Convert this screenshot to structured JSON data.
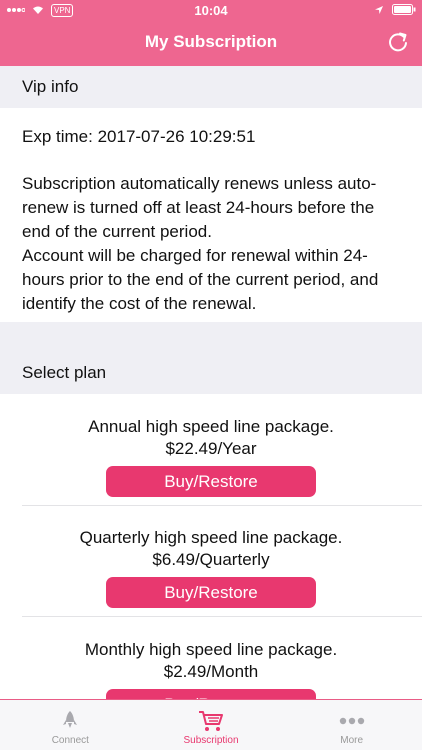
{
  "status_bar": {
    "vpn": "VPN",
    "time": "10:04"
  },
  "nav": {
    "title": "My Subscription",
    "refresh_icon": "refresh-icon"
  },
  "vip_info": {
    "header": "Vip info",
    "exp_time": "Exp time: 2017-07-26 10:29:51",
    "notice_1": "Subscription automatically renews unless auto-renew is turned off at least 24-hours before the end of the current period.",
    "notice_2": "Account will be charged for renewal within 24-hours prior to the end of the current period, and identify the cost of the renewal."
  },
  "select_plan": {
    "header": "Select plan",
    "plans": [
      {
        "name": "Annual high speed line package.",
        "price": "$22.49/Year",
        "button": "Buy/Restore"
      },
      {
        "name": "Quarterly high speed line package.",
        "price": "$6.49/Quarterly",
        "button": "Buy/Restore"
      },
      {
        "name": "Monthly high speed line package.",
        "price": "$2.49/Month",
        "button": "Buy/Restore"
      }
    ]
  },
  "tabbar": {
    "tabs": [
      {
        "label": "Connect",
        "icon": "rocket-icon"
      },
      {
        "label": "Subscription",
        "icon": "cart-icon",
        "active": true
      },
      {
        "label": "More",
        "icon": "more-dots-icon"
      }
    ]
  },
  "colors": {
    "accent": "#ee6690",
    "button": "#e8386f",
    "background": "#efeff4"
  }
}
